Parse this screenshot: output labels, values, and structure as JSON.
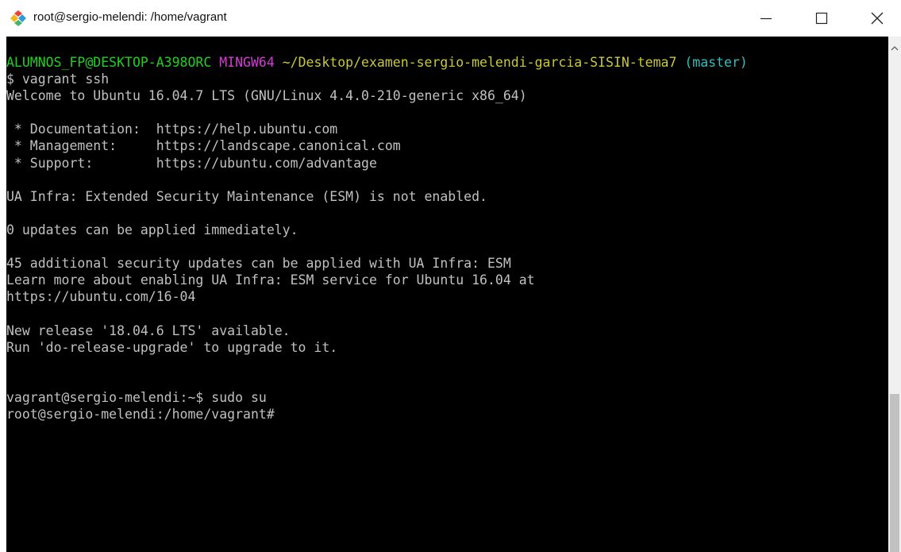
{
  "window": {
    "title": "root@sergio-melendi: /home/vagrant",
    "app_icon": "git-bash-icon",
    "controls": {
      "minimize": "minimize-icon",
      "maximize": "maximize-icon",
      "close": "close-icon"
    }
  },
  "terminal": {
    "prompt_header": {
      "user_host": "ALUMNOS_FP@DESKTOP-A398ORC",
      "env": "MINGW64",
      "path": "~/Desktop/examen-sergio-melendi-garcia-SISIN-tema7",
      "branch": "(master)"
    },
    "lines": [
      "$ vagrant ssh",
      "Welcome to Ubuntu 16.04.7 LTS (GNU/Linux 4.4.0-210-generic x86_64)",
      "",
      " * Documentation:  https://help.ubuntu.com",
      " * Management:     https://landscape.canonical.com",
      " * Support:        https://ubuntu.com/advantage",
      "",
      "UA Infra: Extended Security Maintenance (ESM) is not enabled.",
      "",
      "0 updates can be applied immediately.",
      "",
      "45 additional security updates can be applied with UA Infra: ESM",
      "Learn more about enabling UA Infra: ESM service for Ubuntu 16.04 at",
      "https://ubuntu.com/16-04",
      "",
      "New release '18.04.6 LTS' available.",
      "Run 'do-release-upgrade' to upgrade to it.",
      "",
      "",
      "vagrant@sergio-melendi:~$ sudo su",
      "root@sergio-melendi:/home/vagrant#"
    ]
  },
  "colors": {
    "background": "#000000",
    "text": "#c0c0c0",
    "user_host": "#1fd01f",
    "env": "#d63ad6",
    "path": "#c8c83a",
    "branch": "#2fbfbf"
  }
}
